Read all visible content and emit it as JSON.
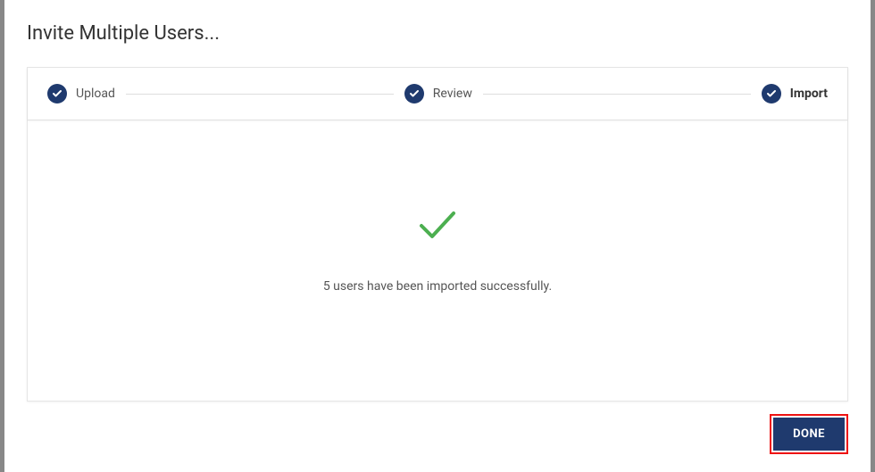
{
  "modal": {
    "title": "Invite Multiple Users..."
  },
  "stepper": {
    "steps": [
      {
        "label": "Upload"
      },
      {
        "label": "Review"
      },
      {
        "label": "Import"
      }
    ]
  },
  "result": {
    "message": "5 users have been imported successfully."
  },
  "footer": {
    "done_label": "DONE"
  },
  "colors": {
    "primary": "#1f3a6e",
    "success": "#4caf50",
    "highlight_border": "#e11"
  }
}
